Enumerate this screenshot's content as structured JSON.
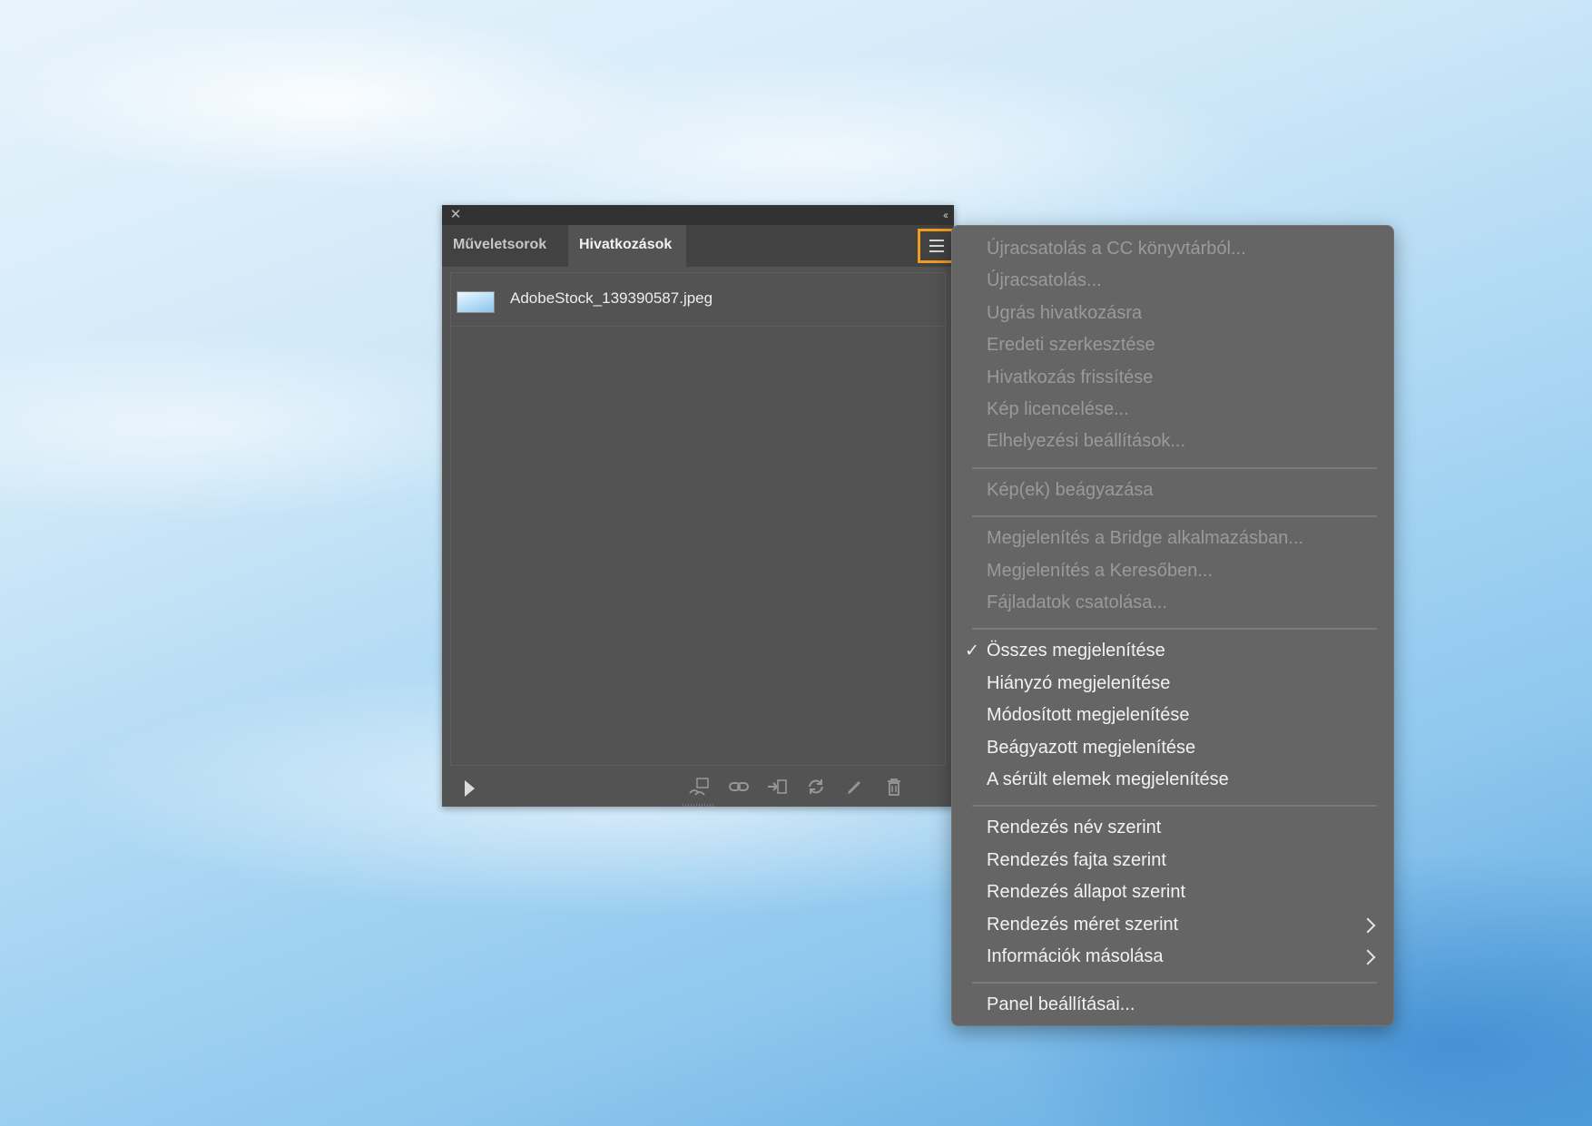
{
  "panel": {
    "tabs": [
      {
        "label": "Műveletsorok",
        "active": false
      },
      {
        "label": "Hivatkozások",
        "active": true
      }
    ],
    "links": [
      {
        "filename": "AdobeStock_139390587.jpeg"
      }
    ],
    "toolbar_icons": [
      "relink-cc-icon",
      "relink-icon",
      "goto-link-icon",
      "update-link-icon",
      "edit-original-icon",
      "delete-icon"
    ]
  },
  "menu": {
    "highlight_color": "#f29c1f",
    "groups": [
      [
        {
          "label": "Újracsatolás a CC könyvtárból...",
          "enabled": false
        },
        {
          "label": "Újracsatolás...",
          "enabled": false
        },
        {
          "label": "Ugrás hivatkozásra",
          "enabled": false
        },
        {
          "label": "Eredeti szerkesztése",
          "enabled": false
        },
        {
          "label": "Hivatkozás frissítése",
          "enabled": false
        },
        {
          "label": "Kép licencelése...",
          "enabled": false
        },
        {
          "label": "Elhelyezési beállítások...",
          "enabled": false
        }
      ],
      [
        {
          "label": "Kép(ek) beágyazása",
          "enabled": false
        }
      ],
      [
        {
          "label": "Megjelenítés a Bridge alkalmazásban...",
          "enabled": false
        },
        {
          "label": "Megjelenítés a Keresőben...",
          "enabled": false
        },
        {
          "label": "Fájladatok csatolása...",
          "enabled": false
        }
      ],
      [
        {
          "label": "Összes megjelenítése",
          "enabled": true,
          "checked": true
        },
        {
          "label": "Hiányzó megjelenítése",
          "enabled": true
        },
        {
          "label": "Módosított megjelenítése",
          "enabled": true
        },
        {
          "label": "Beágyazott megjelenítése",
          "enabled": true
        },
        {
          "label": "A sérült elemek megjelenítése",
          "enabled": true
        }
      ],
      [
        {
          "label": "Rendezés név szerint",
          "enabled": true
        },
        {
          "label": "Rendezés fajta szerint",
          "enabled": true
        },
        {
          "label": "Rendezés állapot szerint",
          "enabled": true
        },
        {
          "label": "Rendezés méret szerint",
          "enabled": true,
          "submenu": true
        },
        {
          "label": "Információk másolása",
          "enabled": true,
          "submenu": true
        }
      ],
      [
        {
          "label": "Panel beállításai...",
          "enabled": true
        }
      ]
    ]
  }
}
